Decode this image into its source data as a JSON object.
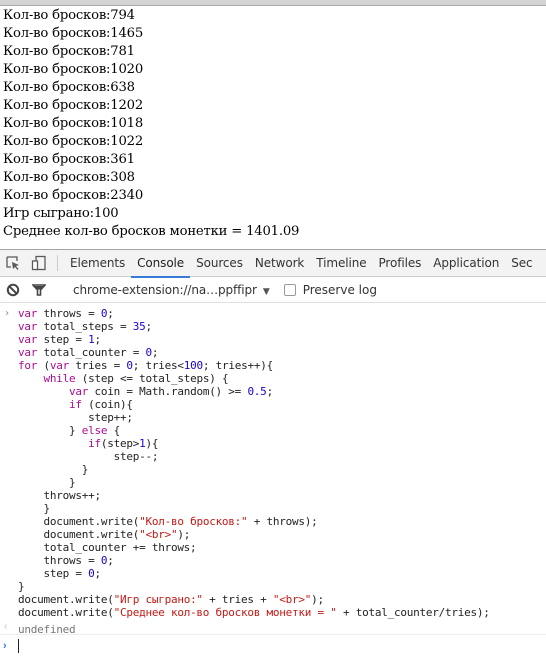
{
  "page": {
    "lines": [
      "Кол-во бросков:794",
      "Кол-во бросков:1465",
      "Кол-во бросков:781",
      "Кол-во бросков:1020",
      "Кол-во бросков:638",
      "Кол-во бросков:1202",
      "Кол-во бросков:1018",
      "Кол-во бросков:1022",
      "Кол-во бросков:361",
      "Кол-во бросков:308",
      "Кол-во бросков:2340",
      "Игр сыграно:100",
      "Среднее кол-во бросков монетки = 1401.09"
    ]
  },
  "devtools": {
    "icons": {
      "inspect": "inspect-element-icon",
      "device": "device-mode-icon",
      "clear": "clear-console-icon",
      "filter": "filter-icon"
    },
    "tabs": [
      {
        "label": "Elements",
        "active": false
      },
      {
        "label": "Console",
        "active": true
      },
      {
        "label": "Sources",
        "active": false
      },
      {
        "label": "Network",
        "active": false
      },
      {
        "label": "Timeline",
        "active": false
      },
      {
        "label": "Profiles",
        "active": false
      },
      {
        "label": "Application",
        "active": false
      },
      {
        "label": "Sec",
        "active": false
      }
    ],
    "toolbar": {
      "context": "chrome-extension://na…ppffipr",
      "dropdown_arrow": "▼",
      "preserve_log_label": "Preserve log",
      "preserve_log_checked": false
    },
    "accent_color": "#3879d9"
  },
  "console": {
    "input_prompt": ">",
    "result_prompt": "<",
    "code": [
      [
        [
          "kw",
          "var"
        ],
        [
          "t",
          " throws = "
        ],
        [
          "num",
          "0"
        ],
        [
          "t",
          ";"
        ]
      ],
      [
        [
          "kw",
          "var"
        ],
        [
          "t",
          " total_steps = "
        ],
        [
          "num",
          "35"
        ],
        [
          "t",
          ";"
        ]
      ],
      [
        [
          "kw",
          "var"
        ],
        [
          "t",
          " step = "
        ],
        [
          "num",
          "1"
        ],
        [
          "t",
          ";"
        ]
      ],
      [
        [
          "kw",
          "var"
        ],
        [
          "t",
          " total_counter = "
        ],
        [
          "num",
          "0"
        ],
        [
          "t",
          ";"
        ]
      ],
      [
        [
          "kw",
          "for"
        ],
        [
          "t",
          " ("
        ],
        [
          "kw",
          "var"
        ],
        [
          "t",
          " tries = "
        ],
        [
          "num",
          "0"
        ],
        [
          "t",
          "; tries<"
        ],
        [
          "num",
          "100"
        ],
        [
          "t",
          "; tries++){"
        ]
      ],
      [
        [
          "t",
          "    "
        ],
        [
          "kw",
          "while"
        ],
        [
          "t",
          " (step <= total_steps) {"
        ]
      ],
      [
        [
          "t",
          "        "
        ],
        [
          "kw",
          "var"
        ],
        [
          "t",
          " coin = Math.random() >= "
        ],
        [
          "num",
          "0.5"
        ],
        [
          "t",
          ";"
        ]
      ],
      [
        [
          "t",
          "        "
        ],
        [
          "kw",
          "if"
        ],
        [
          "t",
          " (coin){"
        ]
      ],
      [
        [
          "t",
          "           step++;"
        ]
      ],
      [
        [
          "t",
          "        } "
        ],
        [
          "kw",
          "else"
        ],
        [
          "t",
          " {"
        ]
      ],
      [
        [
          "t",
          "           "
        ],
        [
          "kw",
          "if"
        ],
        [
          "t",
          "(step>"
        ],
        [
          "num",
          "1"
        ],
        [
          "t",
          "){"
        ]
      ],
      [
        [
          "t",
          "               step--;"
        ]
      ],
      [
        [
          "t",
          "          }"
        ]
      ],
      [
        [
          "t",
          "        }"
        ]
      ],
      [
        [
          "t",
          "    throws++;"
        ]
      ],
      [
        [
          "t",
          "    }"
        ]
      ],
      [
        [
          "t",
          "    document.write("
        ],
        [
          "str",
          "\"Кол-во бросков:\""
        ],
        [
          "t",
          " + throws);"
        ]
      ],
      [
        [
          "t",
          "    document.write("
        ],
        [
          "str",
          "\"<br>\""
        ],
        [
          "t",
          ");"
        ]
      ],
      [
        [
          "t",
          "    total_counter += throws;"
        ]
      ],
      [
        [
          "t",
          "    throws = "
        ],
        [
          "num",
          "0"
        ],
        [
          "t",
          ";"
        ]
      ],
      [
        [
          "t",
          "    step = "
        ],
        [
          "num",
          "0"
        ],
        [
          "t",
          ";"
        ]
      ],
      [
        [
          "t",
          "}"
        ]
      ],
      [
        [
          "t",
          "document.write("
        ],
        [
          "str",
          "\"Игр сыграно:\""
        ],
        [
          "t",
          " + tries + "
        ],
        [
          "str",
          "\"<br>\""
        ],
        [
          "t",
          ");"
        ]
      ],
      [
        [
          "t",
          "document.write("
        ],
        [
          "str",
          "\"Среднее кол-во бросков монетки = \""
        ],
        [
          "t",
          " + total_counter/tries);"
        ]
      ]
    ],
    "result": "undefined",
    "input_value": ""
  }
}
